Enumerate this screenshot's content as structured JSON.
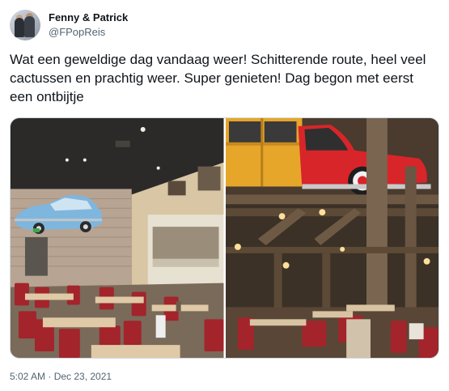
{
  "tweet": {
    "display_name": "Fenny & Patrick",
    "handle": "@FPopReis",
    "text": "Wat een geweldige dag vandaag weer! Schitterende route, heel veel cactussen en prachtig weer. Super genieten! Dag begon met eerst een ontbijtje",
    "timestamp": "5:02 AM · Dec 23, 2021"
  },
  "media": {
    "images": [
      {
        "subject": "diner interior with blue classic car on brick wall"
      },
      {
        "subject": "red and yellow woody car on wooden beams above dining room"
      }
    ]
  },
  "colors": {
    "text": "#0f1419",
    "secondary": "#536471",
    "border": "#cfd9de"
  }
}
